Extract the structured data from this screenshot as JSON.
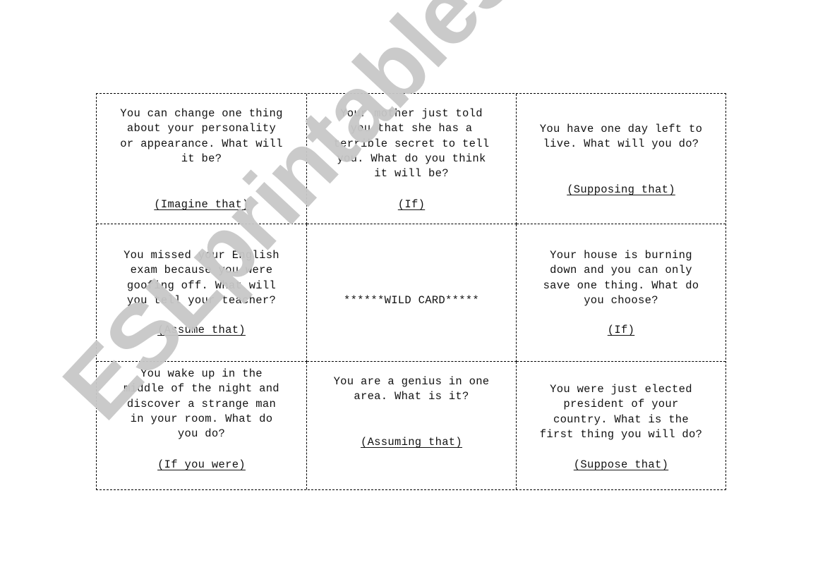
{
  "watermark": "ESLprintables.com",
  "cards": [
    {
      "question": "You can change one thing\nabout your personality\nor appearance. What will\nit be?",
      "hint": "(Imagine that)"
    },
    {
      "question": "Your mother just told\nyou that she has a\nterrible secret to tell\nyou. What do you think\nit will be?",
      "hint": "(If)"
    },
    {
      "question": "You have one day left to\nlive. What will you do?",
      "hint": "(Supposing that)"
    },
    {
      "question": "You missed your English\nexam because  you were\ngoofing off. What will\nyou tell your teacher?",
      "hint": "(Assume that)"
    },
    {
      "question": "******WILD CARD*****",
      "hint": ""
    },
    {
      "question": "Your house is burning\ndown and you can only\nsave one thing. What do\nyou choose?",
      "hint": "(If)"
    },
    {
      "question": "You wake up in the\nmiddle of the night and\ndiscover a strange man\nin your room. What do\nyou do?",
      "hint": "(If you were)"
    },
    {
      "question": "You are a genius in one\narea. What is it?",
      "hint": "(Assuming that)"
    },
    {
      "question": "You were just elected\npresident of your\ncountry. What is the\nfirst thing you will do?",
      "hint": "(Suppose that)"
    }
  ]
}
